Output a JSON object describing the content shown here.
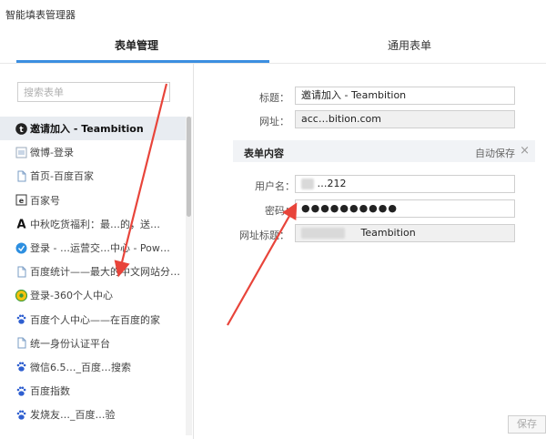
{
  "app": {
    "title": "智能填表管理器"
  },
  "tabs": [
    {
      "label": "表单管理",
      "active": true
    },
    {
      "label": "通用表单",
      "active": false
    }
  ],
  "search": {
    "placeholder": "搜索表单",
    "value": ""
  },
  "sidebar": {
    "items": [
      {
        "icon": "teambition-icon",
        "label": "邀请加入 - Teambition",
        "active": true
      },
      {
        "icon": "weibo-login-icon",
        "label": "微博-登录",
        "active": false
      },
      {
        "icon": "page-icon",
        "label": "首页-百度百家",
        "active": false
      },
      {
        "icon": "baijiahao-icon",
        "label": "百家号",
        "active": false
      },
      {
        "icon": "letter-a-icon",
        "label": "中秋吃货福利：最…的，送…",
        "active": false
      },
      {
        "icon": "blue-circle-icon",
        "label": "登录 - …运营交…中心 - Pow…",
        "active": false
      },
      {
        "icon": "page-icon",
        "label": "百度统计——最大的中文网站分…",
        "active": false
      },
      {
        "icon": "360-icon",
        "label": "登录-360个人中心",
        "active": false
      },
      {
        "icon": "baidu-paw-icon",
        "label": "百度个人中心——在百度的家",
        "active": false
      },
      {
        "icon": "page-icon",
        "label": "统一身份认证平台",
        "active": false
      },
      {
        "icon": "baidu-paw-icon",
        "label": "微信6.5…_百度…搜索",
        "active": false
      },
      {
        "icon": "baidu-paw-icon",
        "label": "百度指数",
        "active": false
      },
      {
        "icon": "baidu-paw-icon",
        "label": "发烧友…_百度…验",
        "active": false
      }
    ]
  },
  "form": {
    "title_label": "标题：",
    "title_value": "邀请加入 - Teambition",
    "url_label": "网址：",
    "url_value": "acc…bition.com",
    "section_title": "表单内容",
    "autosave": "自动保存",
    "close_glyph": "×",
    "username_label": "用户名：",
    "username_value": "…212",
    "password_label": "密码：",
    "password_value": "●●●●●●●●●●",
    "site_label": "网址标题：",
    "site_value": "Teambition"
  },
  "footer": {
    "save_label": "保存"
  },
  "colors": {
    "accent": "#3b8ee0",
    "arrow": "#e8443a",
    "active_row": "#e8ecf1"
  }
}
